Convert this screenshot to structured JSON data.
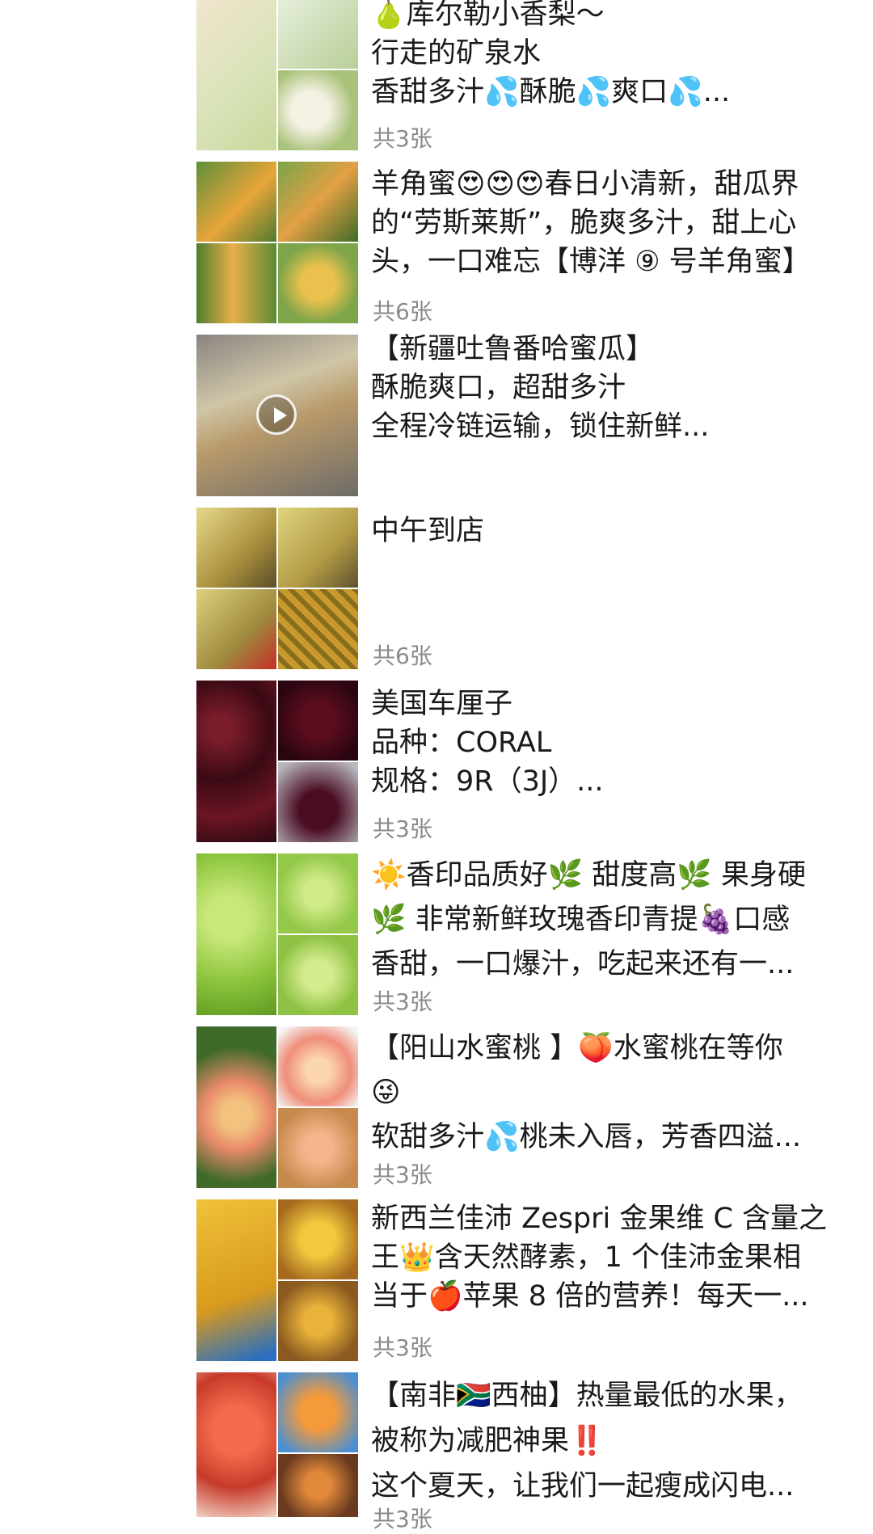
{
  "posts": [
    {
      "lines": [
        "🍐库尔勒小香梨～",
        "行走的矿泉水",
        "香甜多汁💦酥脆💦爽口💦..."
      ],
      "count": "共3张",
      "thumb_icon": "pear-photo-icon"
    },
    {
      "lines": [
        "羊角蜜😍😍😍春日小清新，甜瓜界",
        "的“劳斯莱斯”，脆爽多汁，甜上心",
        "头，一口难忘【博洋 ⑨ 号羊角蜜】"
      ],
      "count": "共6张",
      "thumb_icon": "melon-photo-icon"
    },
    {
      "lines": [
        "【新疆吐鲁番哈蜜瓜】",
        "酥脆爽口，超甜多汁",
        "全程冷链运输，锁住新鲜..."
      ],
      "count": "",
      "thumb_icon": "video-thumbnail-icon"
    },
    {
      "lines": [
        "中午到店"
      ],
      "count": "共6张",
      "thumb_icon": "durian-photo-icon"
    },
    {
      "lines": [
        "美国车厘子",
        "品种：CORAL",
        "规格：9R（3J）..."
      ],
      "count": "共3张",
      "thumb_icon": "cherry-photo-icon"
    },
    {
      "lines": [
        "☀️香印品质好🌿 甜度高🌿 果身硬",
        "🌿 非常新鲜玫瑰香印青提🍇口感",
        "香甜，一口爆汁，吃起来还有一..."
      ],
      "count": "共3张",
      "thumb_icon": "grape-photo-icon"
    },
    {
      "lines": [
        "【阳山水蜜桃 】🍑水蜜桃在等你",
        "😜",
        "软甜多汁💦桃未入唇，芳香四溢..."
      ],
      "count": "共3张",
      "thumb_icon": "peach-photo-icon"
    },
    {
      "lines": [
        "新西兰佳沛 Zespri 金果维 C 含量之",
        "王👑含天然酵素，1 个佳沛金果相",
        "当于🍎苹果 8 倍的营养！每天一..."
      ],
      "count": "共3张",
      "thumb_icon": "kiwi-photo-icon"
    },
    {
      "lines": [
        "【南非🇿🇦西柚】热量最低的水果，",
        "被称为减肥神果‼️",
        "这个夏天，让我们一起瘦成闪电..."
      ],
      "count": "共3张",
      "thumb_icon": "grapefruit-photo-icon"
    }
  ],
  "colors": {
    "text": "#1a1a1a",
    "count": "#8a8a8a",
    "background": "#ffffff"
  }
}
